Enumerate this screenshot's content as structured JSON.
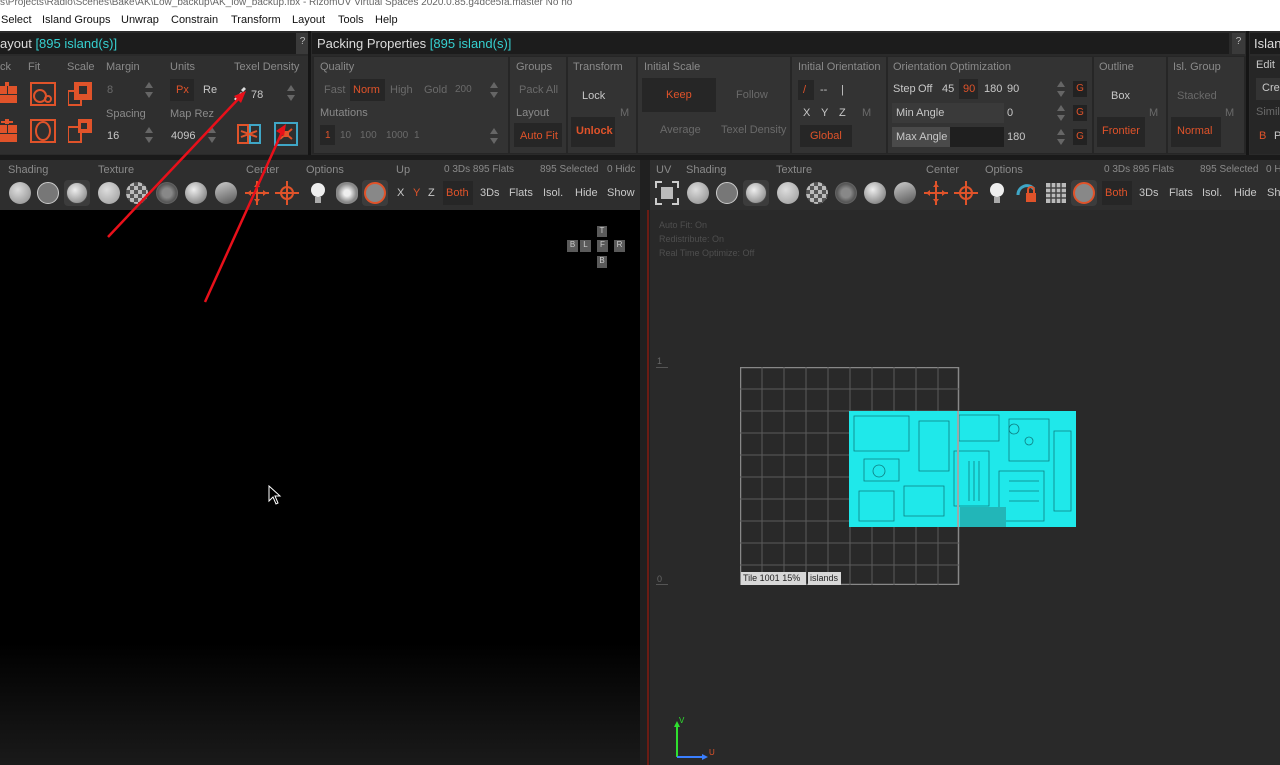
{
  "title_bar": "s\\Projects\\Radio\\Scenes\\Bake\\AK\\Low_backup\\AK_low_backup.fbx - RizomUV Virtual Spaces 2020.0.85.g4dce5fa.master No no",
  "menu": [
    "Select",
    "Island Groups",
    "Unwrap",
    "Constrain",
    "Transform",
    "Layout",
    "Tools",
    "Help"
  ],
  "layout_panel": {
    "title": "ayout",
    "count": "[895 island(s)]",
    "help": "?",
    "labels": {
      "pack": "ck",
      "fit": "Fit",
      "scale": "Scale",
      "margin": "Margin",
      "units": "Units",
      "texel_density": "Texel Density",
      "spacing": "Spacing",
      "map_rez": "Map Rez"
    },
    "margin_value": "8",
    "units_px": "Px",
    "units_re": "Re",
    "texel_value": "78",
    "spacing_value": "16",
    "map_rez_value": "4096"
  },
  "packing_panel": {
    "title": "Packing Properties",
    "count": "[895 island(s)]",
    "help": "?",
    "quality": {
      "label": "Quality",
      "options": [
        "Fast",
        "Norm",
        "High",
        "Gold"
      ],
      "gold_value": "200",
      "selected": "Norm"
    },
    "mutations": {
      "label": "Mutations",
      "values": [
        "1",
        "10",
        "100",
        "1000"
      ],
      "current": "1"
    },
    "groups": {
      "label": "Groups",
      "pack_all": "Pack All"
    },
    "layout": {
      "label": "Layout",
      "auto_fit": "Auto Fit"
    },
    "transform": {
      "label": "Transform",
      "lock": "Lock",
      "unlock": "Unlock",
      "m": "M"
    },
    "initial_scale": {
      "label": "Initial Scale",
      "keep": "Keep",
      "follow": "Follow",
      "average": "Average",
      "texel_density": "Texel Density"
    },
    "initial_orientation": {
      "label": "Initial Orientation",
      "slash": "/",
      "dash": "--",
      "bar": "|",
      "x": "X",
      "y": "Y",
      "z": "Z",
      "m": "M",
      "global": "Global"
    },
    "orientation_opt": {
      "label": "Orientation Optimization",
      "step": "Step",
      "steps": [
        "Off",
        "45",
        "90",
        "180"
      ],
      "step_value": "90",
      "min_angle_label": "Min Angle",
      "min_angle": "0",
      "max_angle_label": "Max Angle",
      "max_angle": "180",
      "g": "G"
    },
    "outline": {
      "label": "Outline",
      "box": "Box",
      "frontier": "Frontier",
      "m": "M"
    },
    "isl_group": {
      "label": "Isl. Group",
      "stacked": "Stacked",
      "normal": "Normal",
      "m": "M"
    }
  },
  "island_panel": {
    "title": "Islan",
    "help": "?",
    "edit": "Edit",
    "cre": "Cre",
    "simi": "Simil",
    "b": "B",
    "p": "P"
  },
  "left_viewport": {
    "toolbar_labels": {
      "shading": "Shading",
      "texture": "Texture",
      "center": "Center",
      "options": "Options",
      "up": "Up",
      "stats": "0 3Ds 895 Flats",
      "selected": "895 Selected",
      "hide": "0 Hidc"
    },
    "axes": [
      "X",
      "Y",
      "Z"
    ],
    "buttons": {
      "both": "Both",
      "threeds": "3Ds",
      "flats": "Flats",
      "isol": "Isol.",
      "hide": "Hide",
      "show": "Show"
    },
    "gizmo": {
      "t": "T",
      "b": "B",
      "l": "L",
      "f": "F",
      "r": "R",
      "bottom": "B"
    }
  },
  "right_viewport": {
    "toolbar_labels": {
      "uv": "UV",
      "shading": "Shading",
      "texture": "Texture",
      "center": "Center",
      "options": "Options",
      "stats": "0 3Ds 895 Flats",
      "selected": "895 Selected",
      "hide": "0 H"
    },
    "buttons": {
      "both": "Both",
      "threeds": "3Ds",
      "flats": "Flats",
      "isol": "Isol.",
      "hide": "Hide",
      "show": "Sh"
    },
    "overlay": [
      "Auto Fit: On",
      "Redistribute: On",
      "Real Time Optimize: Off"
    ],
    "ruler_1": "1",
    "ruler_0": "0",
    "tile_label": "Tile 1001 15%",
    "islands_label": "islands",
    "axis_v": "V",
    "axis_u": "U"
  },
  "colors": {
    "accent": "#e0532a",
    "cyan": "#36d0d0",
    "uv_islands": "#1fe8ea",
    "arrow": "#e8101a"
  }
}
